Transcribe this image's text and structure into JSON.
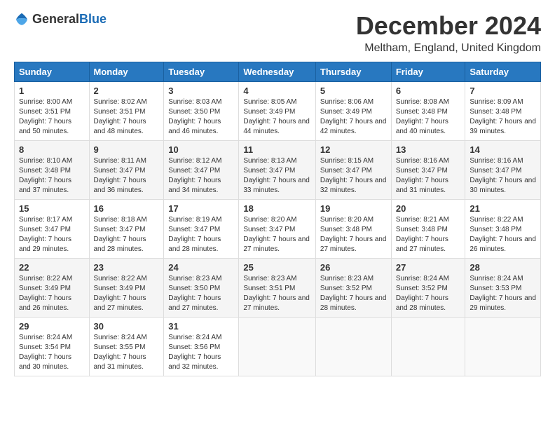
{
  "logo": {
    "general": "General",
    "blue": "Blue"
  },
  "title": "December 2024",
  "location": "Meltham, England, United Kingdom",
  "days_of_week": [
    "Sunday",
    "Monday",
    "Tuesday",
    "Wednesday",
    "Thursday",
    "Friday",
    "Saturday"
  ],
  "weeks": [
    [
      {
        "day": "1",
        "sunrise": "Sunrise: 8:00 AM",
        "sunset": "Sunset: 3:51 PM",
        "daylight": "Daylight: 7 hours and 50 minutes."
      },
      {
        "day": "2",
        "sunrise": "Sunrise: 8:02 AM",
        "sunset": "Sunset: 3:51 PM",
        "daylight": "Daylight: 7 hours and 48 minutes."
      },
      {
        "day": "3",
        "sunrise": "Sunrise: 8:03 AM",
        "sunset": "Sunset: 3:50 PM",
        "daylight": "Daylight: 7 hours and 46 minutes."
      },
      {
        "day": "4",
        "sunrise": "Sunrise: 8:05 AM",
        "sunset": "Sunset: 3:49 PM",
        "daylight": "Daylight: 7 hours and 44 minutes."
      },
      {
        "day": "5",
        "sunrise": "Sunrise: 8:06 AM",
        "sunset": "Sunset: 3:49 PM",
        "daylight": "Daylight: 7 hours and 42 minutes."
      },
      {
        "day": "6",
        "sunrise": "Sunrise: 8:08 AM",
        "sunset": "Sunset: 3:48 PM",
        "daylight": "Daylight: 7 hours and 40 minutes."
      },
      {
        "day": "7",
        "sunrise": "Sunrise: 8:09 AM",
        "sunset": "Sunset: 3:48 PM",
        "daylight": "Daylight: 7 hours and 39 minutes."
      }
    ],
    [
      {
        "day": "8",
        "sunrise": "Sunrise: 8:10 AM",
        "sunset": "Sunset: 3:48 PM",
        "daylight": "Daylight: 7 hours and 37 minutes."
      },
      {
        "day": "9",
        "sunrise": "Sunrise: 8:11 AM",
        "sunset": "Sunset: 3:47 PM",
        "daylight": "Daylight: 7 hours and 36 minutes."
      },
      {
        "day": "10",
        "sunrise": "Sunrise: 8:12 AM",
        "sunset": "Sunset: 3:47 PM",
        "daylight": "Daylight: 7 hours and 34 minutes."
      },
      {
        "day": "11",
        "sunrise": "Sunrise: 8:13 AM",
        "sunset": "Sunset: 3:47 PM",
        "daylight": "Daylight: 7 hours and 33 minutes."
      },
      {
        "day": "12",
        "sunrise": "Sunrise: 8:15 AM",
        "sunset": "Sunset: 3:47 PM",
        "daylight": "Daylight: 7 hours and 32 minutes."
      },
      {
        "day": "13",
        "sunrise": "Sunrise: 8:16 AM",
        "sunset": "Sunset: 3:47 PM",
        "daylight": "Daylight: 7 hours and 31 minutes."
      },
      {
        "day": "14",
        "sunrise": "Sunrise: 8:16 AM",
        "sunset": "Sunset: 3:47 PM",
        "daylight": "Daylight: 7 hours and 30 minutes."
      }
    ],
    [
      {
        "day": "15",
        "sunrise": "Sunrise: 8:17 AM",
        "sunset": "Sunset: 3:47 PM",
        "daylight": "Daylight: 7 hours and 29 minutes."
      },
      {
        "day": "16",
        "sunrise": "Sunrise: 8:18 AM",
        "sunset": "Sunset: 3:47 PM",
        "daylight": "Daylight: 7 hours and 28 minutes."
      },
      {
        "day": "17",
        "sunrise": "Sunrise: 8:19 AM",
        "sunset": "Sunset: 3:47 PM",
        "daylight": "Daylight: 7 hours and 28 minutes."
      },
      {
        "day": "18",
        "sunrise": "Sunrise: 8:20 AM",
        "sunset": "Sunset: 3:47 PM",
        "daylight": "Daylight: 7 hours and 27 minutes."
      },
      {
        "day": "19",
        "sunrise": "Sunrise: 8:20 AM",
        "sunset": "Sunset: 3:48 PM",
        "daylight": "Daylight: 7 hours and 27 minutes."
      },
      {
        "day": "20",
        "sunrise": "Sunrise: 8:21 AM",
        "sunset": "Sunset: 3:48 PM",
        "daylight": "Daylight: 7 hours and 27 minutes."
      },
      {
        "day": "21",
        "sunrise": "Sunrise: 8:22 AM",
        "sunset": "Sunset: 3:48 PM",
        "daylight": "Daylight: 7 hours and 26 minutes."
      }
    ],
    [
      {
        "day": "22",
        "sunrise": "Sunrise: 8:22 AM",
        "sunset": "Sunset: 3:49 PM",
        "daylight": "Daylight: 7 hours and 26 minutes."
      },
      {
        "day": "23",
        "sunrise": "Sunrise: 8:22 AM",
        "sunset": "Sunset: 3:49 PM",
        "daylight": "Daylight: 7 hours and 27 minutes."
      },
      {
        "day": "24",
        "sunrise": "Sunrise: 8:23 AM",
        "sunset": "Sunset: 3:50 PM",
        "daylight": "Daylight: 7 hours and 27 minutes."
      },
      {
        "day": "25",
        "sunrise": "Sunrise: 8:23 AM",
        "sunset": "Sunset: 3:51 PM",
        "daylight": "Daylight: 7 hours and 27 minutes."
      },
      {
        "day": "26",
        "sunrise": "Sunrise: 8:23 AM",
        "sunset": "Sunset: 3:52 PM",
        "daylight": "Daylight: 7 hours and 28 minutes."
      },
      {
        "day": "27",
        "sunrise": "Sunrise: 8:24 AM",
        "sunset": "Sunset: 3:52 PM",
        "daylight": "Daylight: 7 hours and 28 minutes."
      },
      {
        "day": "28",
        "sunrise": "Sunrise: 8:24 AM",
        "sunset": "Sunset: 3:53 PM",
        "daylight": "Daylight: 7 hours and 29 minutes."
      }
    ],
    [
      {
        "day": "29",
        "sunrise": "Sunrise: 8:24 AM",
        "sunset": "Sunset: 3:54 PM",
        "daylight": "Daylight: 7 hours and 30 minutes."
      },
      {
        "day": "30",
        "sunrise": "Sunrise: 8:24 AM",
        "sunset": "Sunset: 3:55 PM",
        "daylight": "Daylight: 7 hours and 31 minutes."
      },
      {
        "day": "31",
        "sunrise": "Sunrise: 8:24 AM",
        "sunset": "Sunset: 3:56 PM",
        "daylight": "Daylight: 7 hours and 32 minutes."
      },
      null,
      null,
      null,
      null
    ]
  ]
}
